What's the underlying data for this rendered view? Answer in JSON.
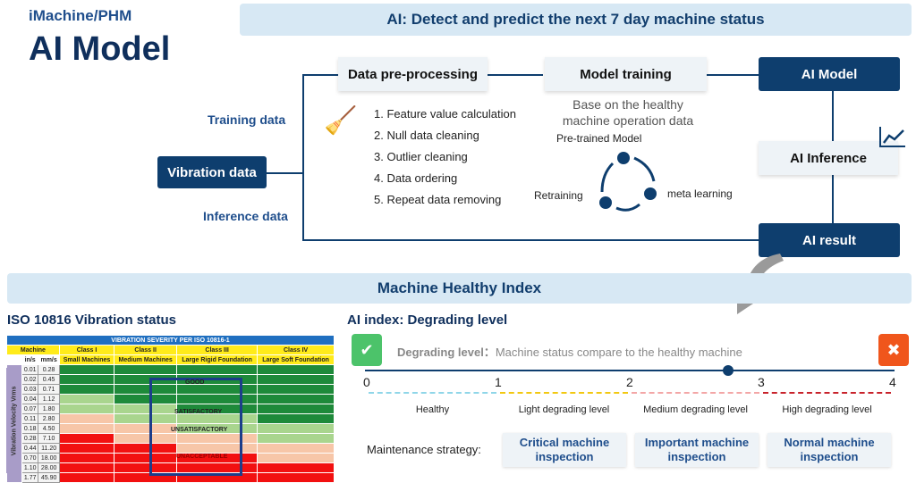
{
  "header": {
    "brand": "iMachine/PHM",
    "title": "AI Model"
  },
  "top_banner": "AI: Detect and predict the next 7 day machine status",
  "flow": {
    "vibration": "Vibration data",
    "training_label": "Training data",
    "inference_label": "Inference data",
    "preprocess": "Data pre-processing",
    "steps": [
      "1.  Feature value calculation",
      "2.  Null data cleaning",
      "3.  Outlier cleaning",
      "4.  Data ordering",
      "5.  Repeat data removing"
    ],
    "training": "Model training",
    "training_desc": "Base on the healthy machine operation data",
    "pretrained": "Pre-trained Model",
    "retraining": "Retraining",
    "meta": "meta learning",
    "ai_model": "AI Model",
    "ai_inference": "AI Inference",
    "ai_result": "AI result"
  },
  "mid_banner": "Machine Healthy Index",
  "iso": {
    "heading": "ISO 10816 Vibration status",
    "table_title": "VIBRATION SEVERITY PER ISO 10816-1",
    "machine": "Machine",
    "unit_in": "in/s",
    "unit_mm": "mm/s",
    "axis": "Vibration Velocity Vrms",
    "classes": [
      {
        "c": "Class I",
        "d": "Small Machines"
      },
      {
        "c": "Class II",
        "d": "Medium Machines"
      },
      {
        "c": "Class III",
        "d": "Large Rigid Foundation"
      },
      {
        "c": "Class IV",
        "d": "Large Soft Foundation"
      }
    ],
    "rows": [
      [
        "0.01",
        "0.28"
      ],
      [
        "0.02",
        "0.45"
      ],
      [
        "0.03",
        "0.71"
      ],
      [
        "0.04",
        "1.12"
      ],
      [
        "0.07",
        "1.80"
      ],
      [
        "0.11",
        "2.80"
      ],
      [
        "0.18",
        "4.50"
      ],
      [
        "0.28",
        "7.10"
      ],
      [
        "0.44",
        "11.20"
      ],
      [
        "0.70",
        "18.00"
      ],
      [
        "1.10",
        "28.00"
      ],
      [
        "1.77",
        "45.90"
      ]
    ],
    "zones": [
      [
        "G",
        "G",
        "G",
        "G"
      ],
      [
        "G",
        "G",
        "G",
        "G"
      ],
      [
        "G",
        "G",
        "G",
        "G"
      ],
      [
        "L",
        "G",
        "G",
        "G"
      ],
      [
        "L",
        "L",
        "G",
        "G"
      ],
      [
        "S",
        "L",
        "L",
        "G"
      ],
      [
        "S",
        "S",
        "L",
        "L"
      ],
      [
        "R",
        "S",
        "S",
        "L"
      ],
      [
        "R",
        "R",
        "S",
        "S"
      ],
      [
        "R",
        "R",
        "R",
        "S"
      ],
      [
        "R",
        "R",
        "R",
        "R"
      ],
      [
        "R",
        "R",
        "R",
        "R"
      ]
    ],
    "zone_labels": {
      "good": "GOOD",
      "satisfactory": "SATISFACTORY",
      "unsatisfactory": "UNSATISFACTORY",
      "unacceptable": "UNACCEPTABLE"
    },
    "colors": {
      "G": "#1e8a3a",
      "L": "#a9d58e",
      "S": "#f7c6a8",
      "R": "#f21010"
    }
  },
  "ai_index": {
    "heading": "AI index: Degrading level",
    "degrading_label": "Degrading level：",
    "degrading_desc": "Machine status compare to the healthy machine",
    "ticks": [
      "0",
      "1",
      "2",
      "3",
      "4"
    ],
    "current_value": 2.75,
    "levels": [
      "Healthy",
      "Light degrading level",
      "Medium degrading level",
      "High degrading level"
    ],
    "strategy_label": "Maintenance strategy:",
    "strategies": [
      "Critical machine inspection",
      "Important machine inspection",
      "Normal machine inspection"
    ],
    "level_colors": [
      "#8fd6e8",
      "#f2c811",
      "#f3a6a6",
      "#c8232c"
    ]
  }
}
